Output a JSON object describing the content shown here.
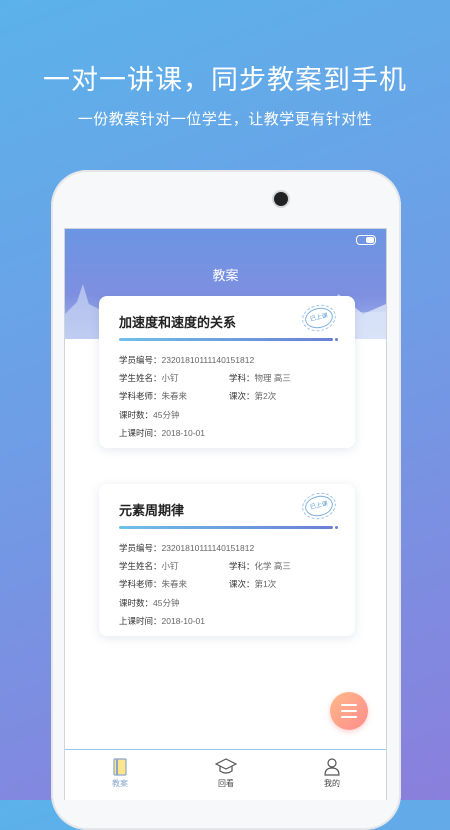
{
  "promo": {
    "headline": "一对一讲课，同步教案到手机",
    "subline": "一份教案针对一位学生，让教学更有针对性"
  },
  "screen": {
    "title": "教案"
  },
  "cards": [
    {
      "title": "加速度和速度的关系",
      "stamp": "已上课",
      "student_id_label": "学员编号：",
      "student_id": "23201810111140151812",
      "student_name_label": "学生姓名：",
      "student_name": "小钉",
      "subject_label": "学科：",
      "subject": "物理 高三",
      "teacher_label": "学科老师：",
      "teacher": "朱春来",
      "session_label": "课次：",
      "session": "第2次",
      "hours_label": "课时数：",
      "hours": "45分钟",
      "time_label": "上课时间：",
      "time": "2018-10-01"
    },
    {
      "title": "元素周期律",
      "stamp": "已上课",
      "student_id_label": "学员编号：",
      "student_id": "23201810111140151812",
      "student_name_label": "学生姓名：",
      "student_name": "小钉",
      "subject_label": "学科：",
      "subject": "化学 高三",
      "teacher_label": "学科老师：",
      "teacher": "朱春来",
      "session_label": "课次：",
      "session": "第1次",
      "hours_label": "课时数：",
      "hours": "45分钟",
      "time_label": "上课时间：",
      "time": "2018-10-01"
    }
  ],
  "tabbar": {
    "items": [
      {
        "label": "教案",
        "icon": "book-icon",
        "active": true
      },
      {
        "label": "回看",
        "icon": "graduation-cap-icon",
        "active": false
      },
      {
        "label": "我的",
        "icon": "person-icon",
        "active": false
      }
    ]
  },
  "colors": {
    "accent": "#6c7fd6",
    "fab": "#ff8c8c"
  }
}
